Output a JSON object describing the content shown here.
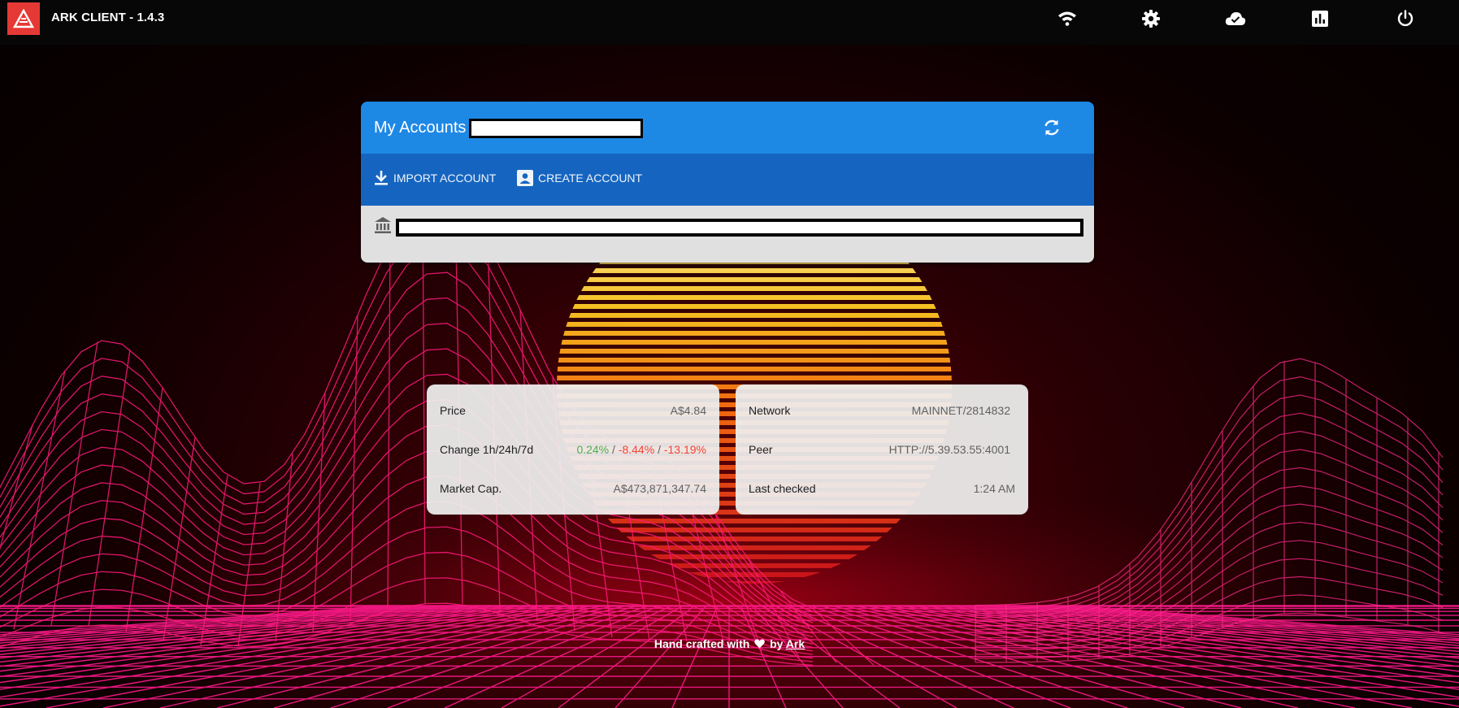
{
  "app": {
    "title": "ARK CLIENT - 1.4.3",
    "logo_icon": "ark-logo-icon",
    "brand_color": "#e53935"
  },
  "topbar": {
    "icons": [
      "wifi-icon",
      "settings-gear-icon",
      "cloud-check-icon",
      "chart-icon",
      "power-icon"
    ]
  },
  "accounts": {
    "title": "My Accounts",
    "import_label": "IMPORT ACCOUNT",
    "create_label": "CREATE ACCOUNT",
    "header_color": "#1e88e5",
    "toolbar_color": "#1565c0"
  },
  "market": {
    "price_label": "Price",
    "price_value": "A$4.84",
    "change_label": "Change 1h/24h/7d",
    "change_1h": "0.24%",
    "change_24h": "-8.44%",
    "change_7d": "-13.19%",
    "separator": "/",
    "marketcap_label": "Market Cap.",
    "marketcap_value": "A$473,871,347.74",
    "positive_color": "#4caf50",
    "negative_color": "#f44336"
  },
  "network": {
    "network_label": "Network",
    "network_value": "MAINNET/2814832",
    "peer_label": "Peer",
    "peer_value": "HTTP://5.39.53.55:4001",
    "checked_label": "Last checked",
    "checked_value": "1:24 AM"
  },
  "footer": {
    "prefix": "Hand crafted with",
    "by": "by",
    "link": "Ark"
  }
}
